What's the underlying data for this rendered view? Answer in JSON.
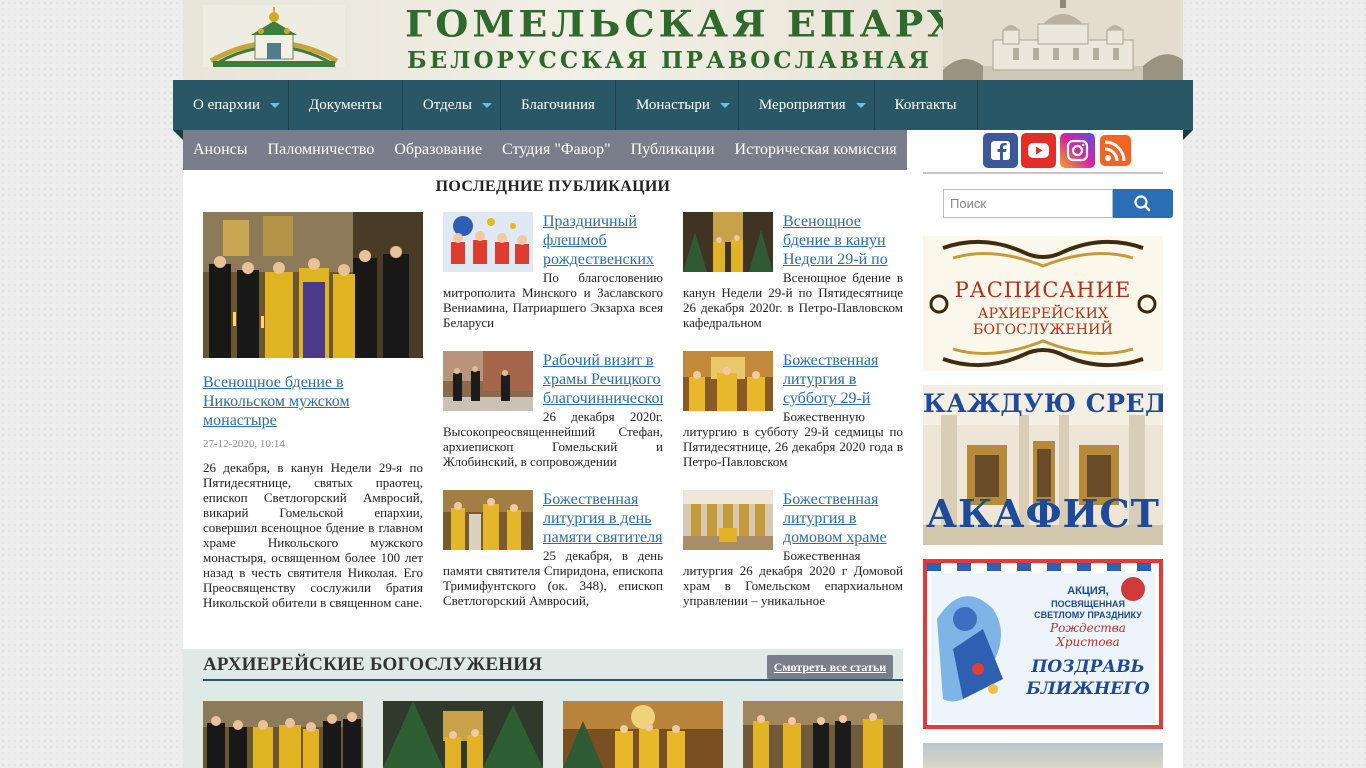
{
  "header": {
    "title": "ГОМЕЛЬСКАЯ ЕПАРХИЯ",
    "subtitle": "БЕЛОРУССКАЯ ПРАВОСЛАВНАЯ ЦЕРКОВЬ"
  },
  "topnav": {
    "items": [
      {
        "label": "О епархии"
      },
      {
        "label": "Документы"
      },
      {
        "label": "Отделы"
      },
      {
        "label": "Благочиния"
      },
      {
        "label": "Монастыри"
      },
      {
        "label": "Мероприятия"
      },
      {
        "label": "Контакты"
      }
    ]
  },
  "subnav": {
    "items": [
      {
        "label": "Анонсы"
      },
      {
        "label": "Паломничество"
      },
      {
        "label": "Образование"
      },
      {
        "label": "Студия \"Фавор\""
      },
      {
        "label": "Публикации"
      },
      {
        "label": "Историческая комиссия"
      }
    ]
  },
  "main": {
    "section_title": "ПОСЛЕДНИЕ ПУБЛИКАЦИИ",
    "featured": {
      "title": "Всенощное бдение в Никольском мужском монастыре",
      "date": "27-12-2020, 10:14",
      "text": "26 декабря, в канун Недели 29-я по Пятидесятнице, святых праотец, епископ Светлогорский Амвросий, викарий Гомельской епархии, совершил всенощное бдение в главном храме Никольского мужского монастыря, освященном более 100 лет назад в честь святителя Николая. Его Преосвященству сослужили братия Никольской обители в священном сане."
    },
    "posts": [
      {
        "title": "Праздничный флешмоб рождественских",
        "text": "По благословению митрополита Минского и Заславского Вениамина, Патриаршего Экзарха всея Беларуси"
      },
      {
        "title": "Всенощное бдение в канун Недели 29-й по",
        "text": "Всенощное бдение в канун Недели 29-й по Пятидесятнице 26 декабря 2020г. в Петро-Павловском кафедральном"
      },
      {
        "title": "Рабочий визит в храмы Речицкого благочиннического",
        "text": "26 декабря 2020г. Высокопреосвященнейший Стефан, архиепископ Гомельский и Жлобинский, в сопровождении"
      },
      {
        "title": "Божественная литургия в субботу 29-й",
        "text": "Божественную литургию в субботу 29-й седмицы по Пятидесятнице, 26 декабря 2020 года в Петро-Павловском"
      },
      {
        "title": "Божественная литургия в день памяти святителя",
        "text": "25 декабря, в день памяти святителя Спиридона, епископа Тримифунтского (ок. 348), епископ Светлогорский Амвросий,"
      },
      {
        "title": "Божественная литургия в домовом храме",
        "text": "Божественная литургия 26 декабря 2020 г Домовой храм в Гомельском епархиальном управлении – уникальное"
      }
    ]
  },
  "bottom": {
    "title": "АРХИЕРЕЙСКИЕ БОГОСЛУЖЕНИЯ",
    "see_all": "Смотреть все статьи"
  },
  "sidebar": {
    "social": [
      {
        "icon": "facebook-icon",
        "color": "#3b5998"
      },
      {
        "icon": "youtube-icon",
        "color": "#e52d27"
      },
      {
        "icon": "instagram-icon",
        "color": "#c13584"
      },
      {
        "icon": "rss-icon",
        "color": "#f26522"
      }
    ],
    "search": {
      "placeholder": "Поиск",
      "value": ""
    },
    "banners": {
      "schedule": {
        "line1": "РАСПИСАНИЕ",
        "line2": "АРХИЕРЕЙСКИХ БОГОСЛУЖЕНИЙ"
      },
      "akathist": {
        "line1": "КАЖДУЮ СРЕДУ",
        "line2": "АКАФИСТ"
      },
      "christmas": {
        "line1": "АКЦИЯ,",
        "line2": "ПОСВЯЩЕННАЯ",
        "line3": "СВЕТЛОМУ ПРАЗДНИКУ",
        "line4": "Рождества Христова",
        "line5": "ПОЗДРАВЬ",
        "line6": "БЛИЖНЕГО"
      }
    }
  },
  "colors": {
    "nav": "#2a5766",
    "subnav": "#7a7d8a",
    "link": "#2b6fa6",
    "title_green": "#2d6a2b"
  }
}
